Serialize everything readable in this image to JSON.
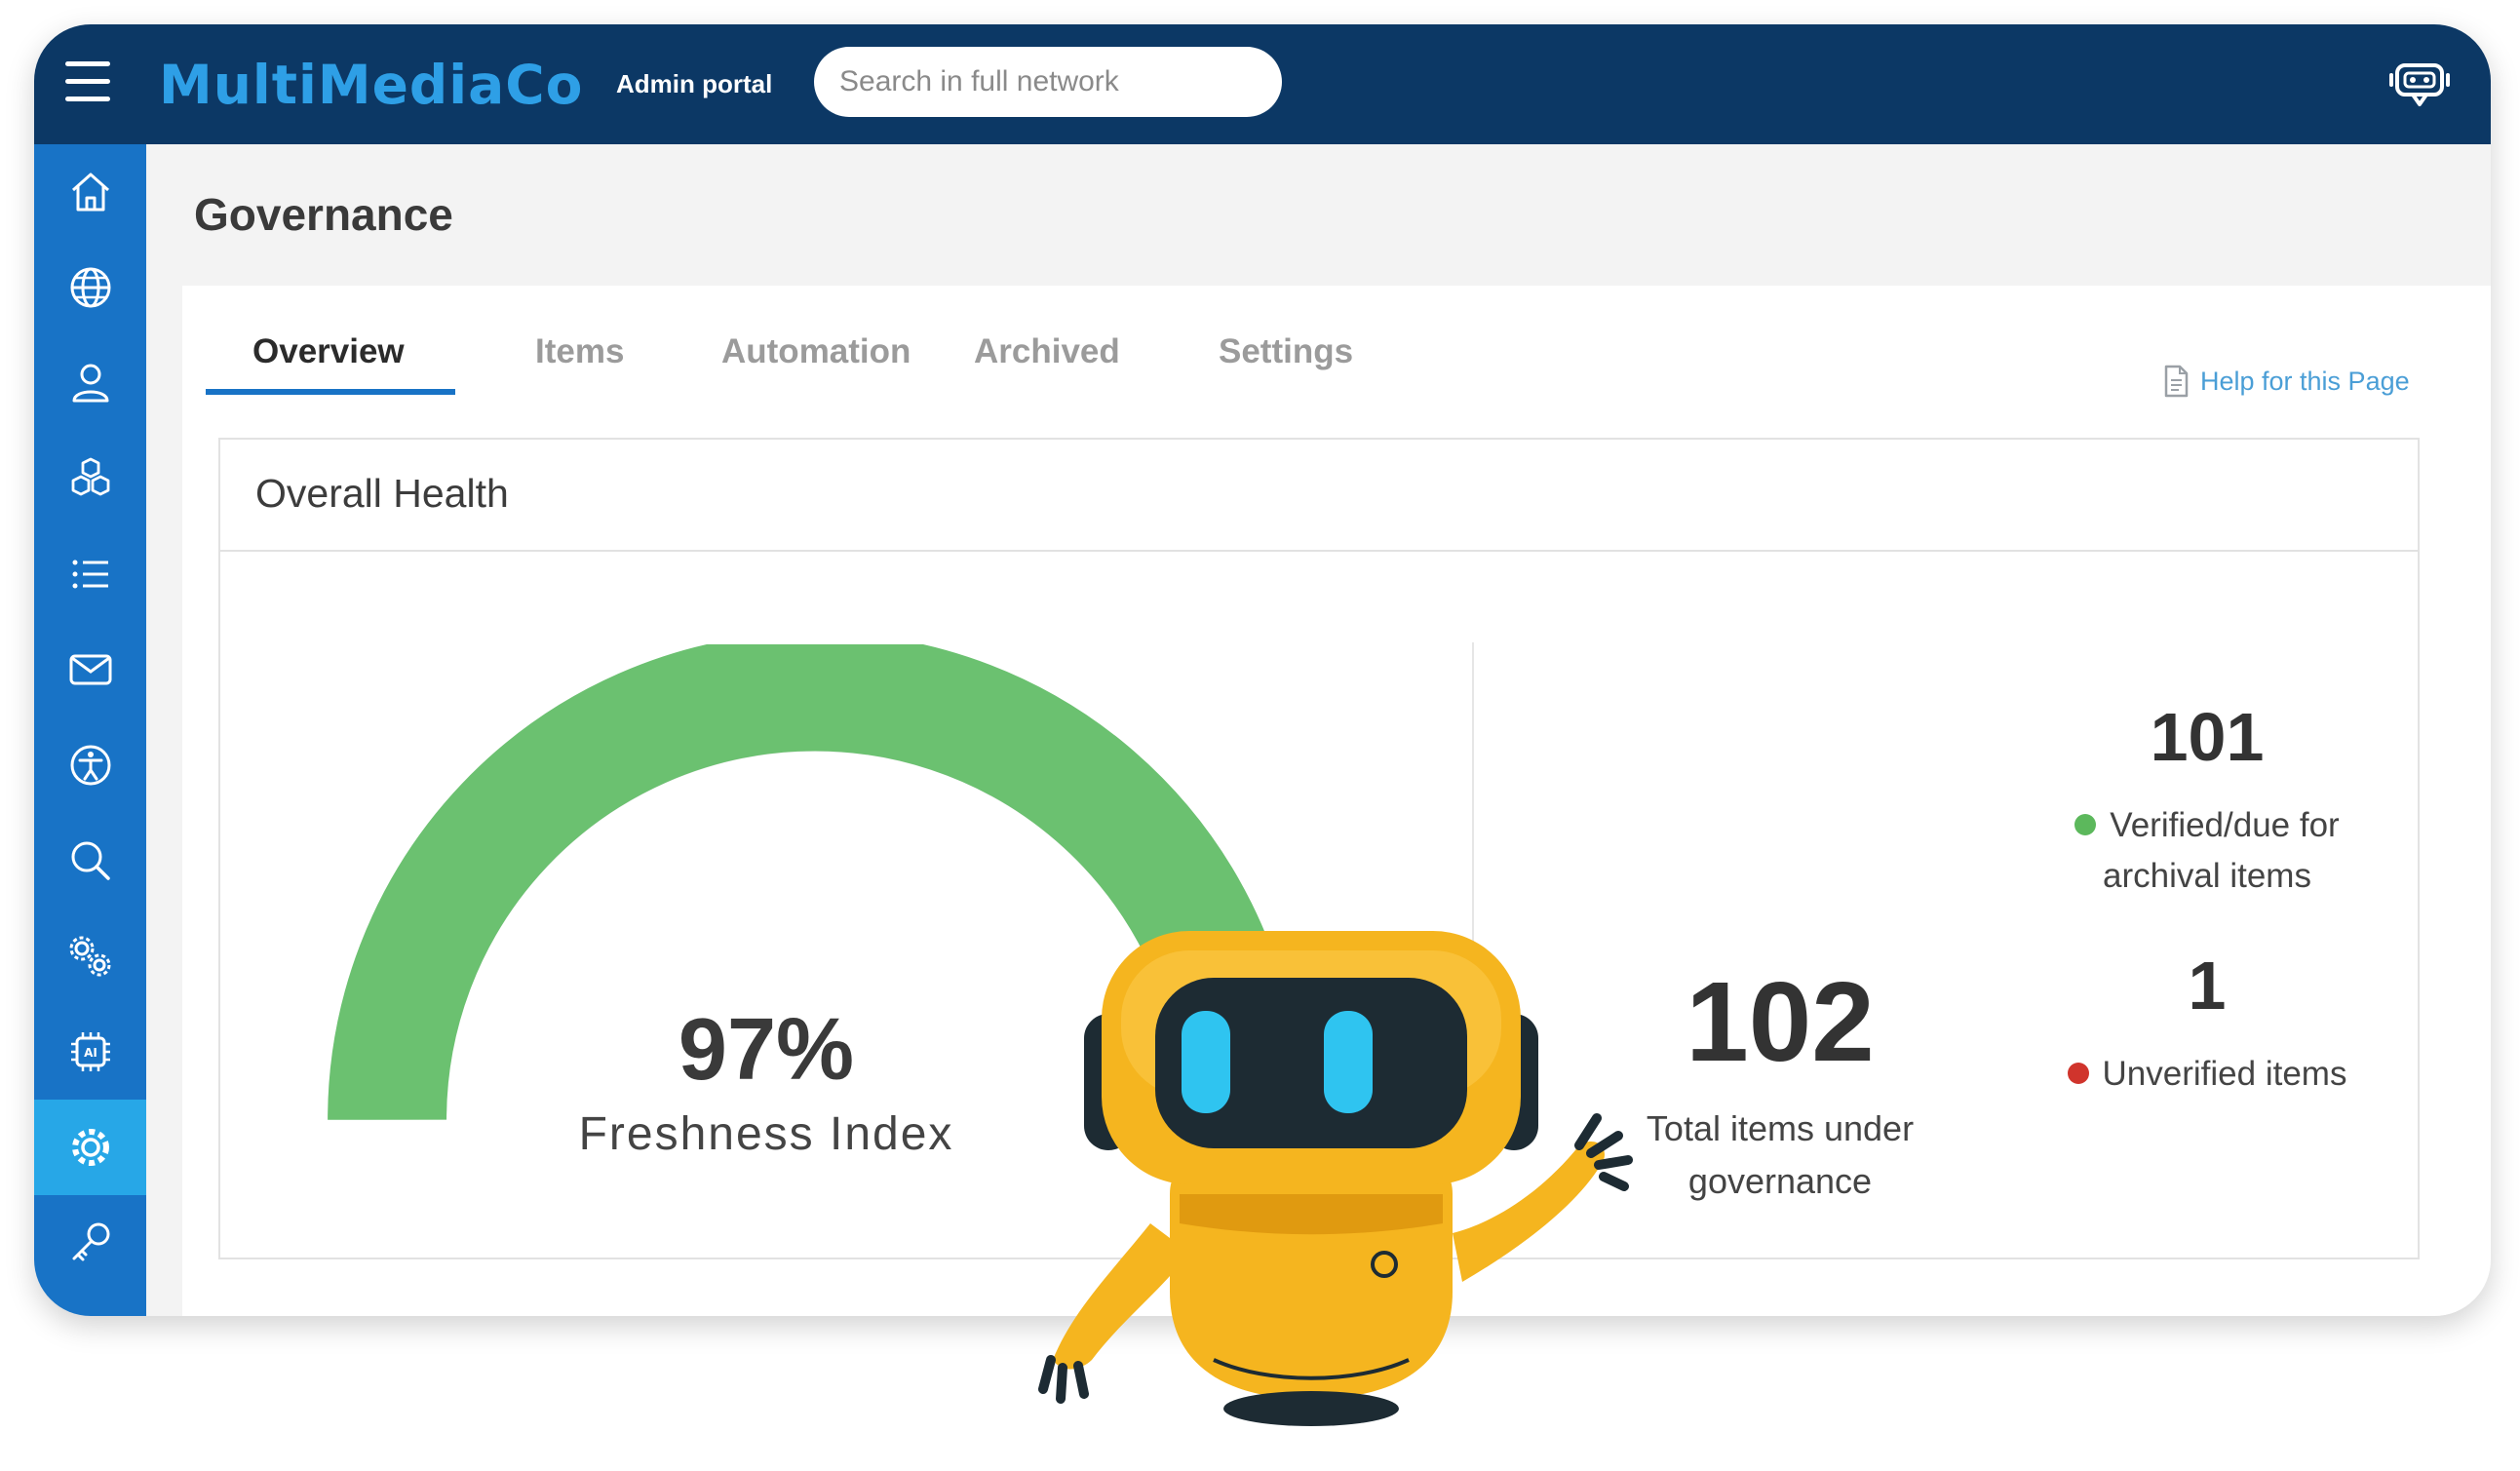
{
  "app": {
    "brand": "MultiMediaCo",
    "portal_label": "Admin portal",
    "search": {
      "placeholder": "Search in full network"
    }
  },
  "sidebar": {
    "items": [
      {
        "icon": "home-icon"
      },
      {
        "icon": "globe-icon"
      },
      {
        "icon": "user-icon"
      },
      {
        "icon": "cubes-icon"
      },
      {
        "icon": "list-icon"
      },
      {
        "icon": "mail-icon"
      },
      {
        "icon": "accessibility-icon"
      },
      {
        "icon": "search-icon"
      },
      {
        "icon": "settings-gears-icon"
      },
      {
        "icon": "ai-chip-icon"
      },
      {
        "icon": "gear-icon",
        "active": true
      },
      {
        "icon": "key-icon"
      }
    ]
  },
  "page": {
    "title": "Governance",
    "tabs": [
      "Overview",
      "Items",
      "Automation",
      "Archived",
      "Settings"
    ],
    "active_tab": "Overview",
    "help_link": "Help for this Page"
  },
  "overall_health": {
    "title": "Overall Health",
    "freshness": {
      "value": "97%",
      "fraction": 0.97,
      "label": "Freshness Index"
    },
    "total": {
      "value": "102",
      "label_line1": "Total items under",
      "label_line2": "governance"
    },
    "verified": {
      "value": "101",
      "label_line1": "Verified/due for",
      "label_line2": "archival items"
    },
    "unverified": {
      "value": "1",
      "label": "Unverified items"
    }
  },
  "colors": {
    "topbar": "#0c3865",
    "sidebar": "#1873c6",
    "sidebar_active": "#27a7e7",
    "brand": "#2e9fe6",
    "gauge_fill": "#6bc170",
    "verified_dot": "#5cb85c",
    "unverified_dot": "#d0342c",
    "robot_body": "#f5b51f"
  }
}
